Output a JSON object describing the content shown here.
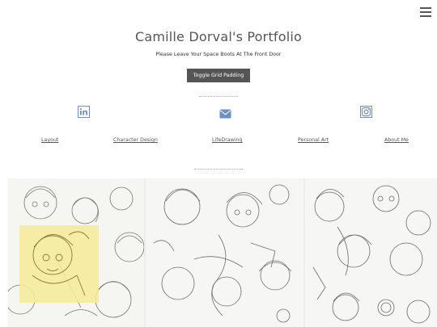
{
  "header": {
    "title": "Camille Dorval's Portfolio",
    "subtitle": "Please Leave Your Space Boots At The Front Door",
    "toggle_label": "Toggle Grid Padding",
    "menu_icon": "hamburger-menu-icon"
  },
  "social": {
    "icons": [
      "linkedin-icon",
      "mail-icon",
      "instagram-icon"
    ],
    "accent_color": "#6d8fc4"
  },
  "nav": {
    "layout": "Layout",
    "character_design": "Character Design",
    "life_drawing": "LifeDrawing",
    "personal_art": "Personal Art",
    "about_me": "About Me"
  },
  "gallery": {
    "items": [
      "sketch-page-1",
      "sketch-page-2",
      "sketch-page-3"
    ],
    "highlight_color": "#f5ea9a"
  }
}
